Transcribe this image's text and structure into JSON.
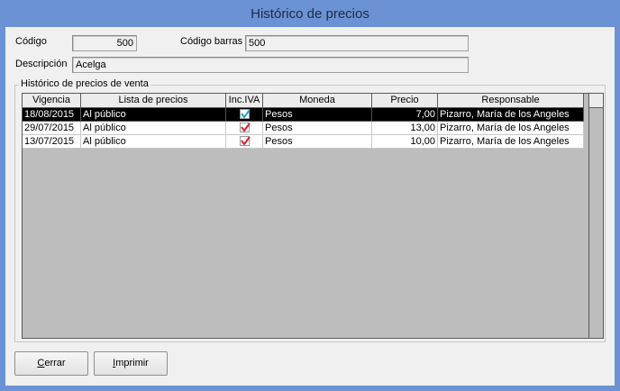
{
  "window": {
    "title": "Histórico de precios"
  },
  "form": {
    "codigo_label": "Código",
    "codigo_value": "500",
    "codigo_barras_label": "Código barras",
    "codigo_barras_value": "500",
    "descripcion_label": "Descripción",
    "descripcion_value": "Acelga"
  },
  "group": {
    "title": "Histórico de precios de venta"
  },
  "grid": {
    "columns": [
      "Vigencia",
      "Lista de precios",
      "Inc.IVA",
      "Moneda",
      "Precio",
      "Responsable"
    ],
    "rows": [
      {
        "vigencia": "18/08/2015",
        "lista": "Al público",
        "inc_iva": true,
        "moneda": "Pesos",
        "precio": "7,00",
        "responsable": "Pizarro, María de los Angeles",
        "selected": true
      },
      {
        "vigencia": "29/07/2015",
        "lista": "Al público",
        "inc_iva": true,
        "moneda": "Pesos",
        "precio": "13,00",
        "responsable": "Pizarro, María de los Angeles",
        "selected": false
      },
      {
        "vigencia": "13/07/2015",
        "lista": "Al público",
        "inc_iva": true,
        "moneda": "Pesos",
        "precio": "10,00",
        "responsable": "Pizarro, María de los Angeles",
        "selected": false
      }
    ]
  },
  "buttons": {
    "cerrar_first": "C",
    "cerrar_rest": "errar",
    "imprimir_first": "I",
    "imprimir_rest": "mprimir"
  },
  "colors": {
    "titlebar": "#6b92d4",
    "grid_bg": "#bdbdbd",
    "selected_row": "#000000",
    "check_selected": "#1aa0c8",
    "check_normal": "#d0202a"
  }
}
